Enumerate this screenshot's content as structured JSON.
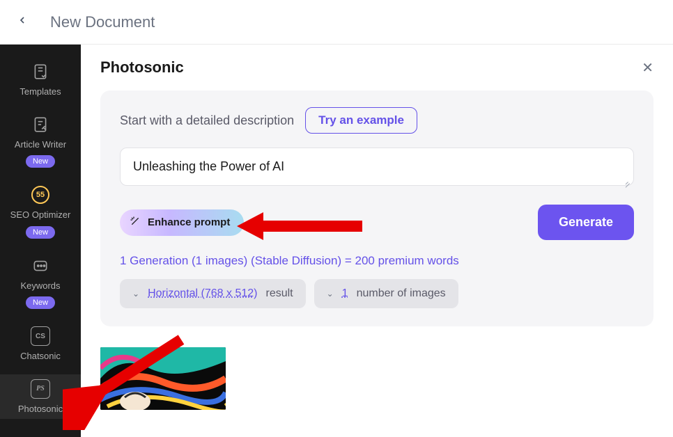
{
  "header": {
    "title": "New Document"
  },
  "sidebar": {
    "items": [
      {
        "label": "Templates",
        "icon": "templates-icon",
        "badge": null
      },
      {
        "label": "Article Writer",
        "icon": "article-icon",
        "badge": "New"
      },
      {
        "label": "SEO Optimizer",
        "icon": "seo-icon",
        "badge": "New",
        "score": "55"
      },
      {
        "label": "Keywords",
        "icon": "keywords-icon",
        "badge": "New"
      },
      {
        "label": "Chatsonic",
        "icon": "cs-icon",
        "badge": null,
        "box": "CS"
      },
      {
        "label": "Photosonic",
        "icon": "ps-icon",
        "badge": null,
        "box": "PS",
        "active": true
      }
    ]
  },
  "panel": {
    "title": "Photosonic",
    "description_label": "Start with a detailed description",
    "try_example_label": "Try an example",
    "prompt_value": "Unleashing the Power of AI",
    "enhance_label": "Enhance prompt",
    "generate_label": "Generate",
    "info": "1 Generation (1 images) (Stable Diffusion) = 200 premium words",
    "option_size_link": "Horizontal (768 x 512)",
    "option_size_suffix": "result",
    "option_count_link": "1",
    "option_count_suffix": "number of images"
  }
}
